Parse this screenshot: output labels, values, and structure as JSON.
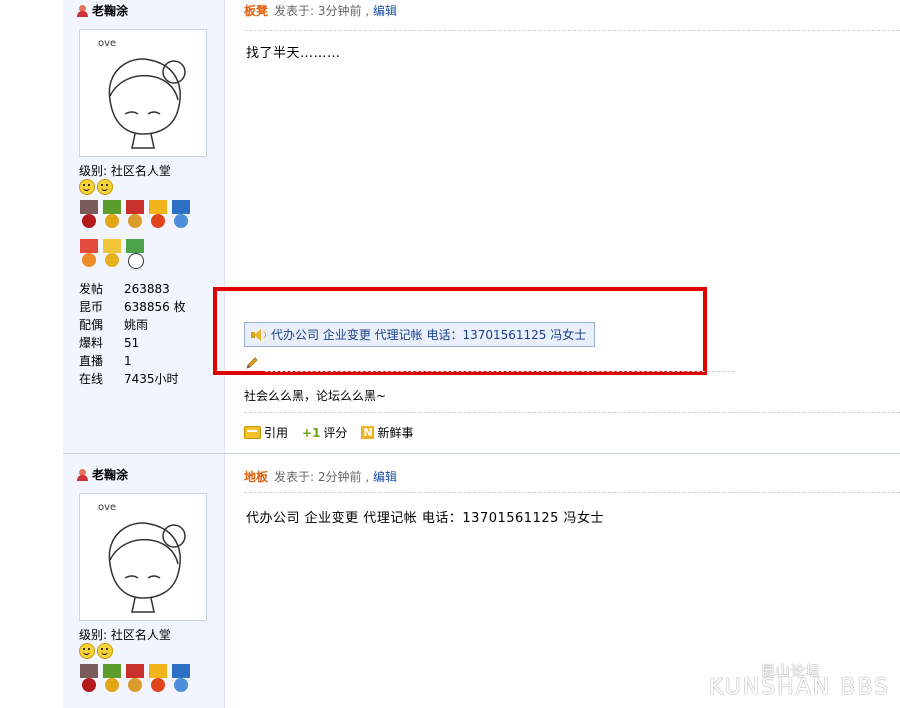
{
  "posts": [
    {
      "author": "老鞠涂",
      "avatar_text": "ove",
      "level": "级别: 社区名人堂",
      "stats": [
        {
          "label": "发帖",
          "value": "263883"
        },
        {
          "label": "昆币",
          "value": "638856 枚"
        },
        {
          "label": "配偶",
          "value": "姚雨"
        },
        {
          "label": "爆料",
          "value": "51"
        },
        {
          "label": "直播",
          "value": "1"
        },
        {
          "label": "在线",
          "value": "7435小时"
        }
      ],
      "floor": "板凳",
      "posted": "发表于: 3分钟前 ,",
      "edit": "编辑",
      "body": "找了半天………",
      "ad": "代办公司 企业变更 代理记帐 电话：13701561125  冯女士",
      "signature": "社会么么黑，论坛么么黑~",
      "actions": {
        "quote": "引用",
        "rate": "评分",
        "news": "新鲜事"
      }
    },
    {
      "author": "老鞠涂",
      "avatar_text": "ove",
      "level": "级别: 社区名人堂",
      "floor": "地板",
      "posted": "发表于: 2分钟前 ,",
      "edit": "编辑",
      "body": "代办公司 企业变更 代理记帐 电话：13701561125  冯女士"
    }
  ],
  "watermark": {
    "brand": "KUNSHAN",
    "cn": "昆山论坛",
    "logo": "BBS"
  },
  "colors": {
    "floor": "#e05e0f",
    "link": "#1c4fa8",
    "highlight": "#e00000",
    "author_bg": "#f2f5fd"
  }
}
